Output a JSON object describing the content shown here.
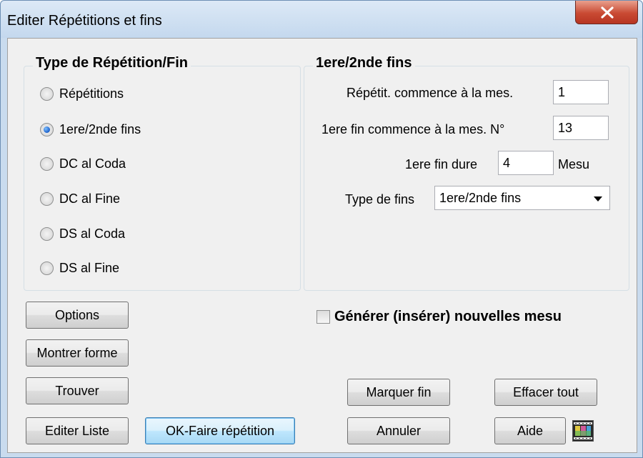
{
  "window": {
    "title": "Editer Répétitions et fins"
  },
  "type_group": {
    "title": "Type de Répétition/Fin",
    "options": [
      {
        "label": "Répétitions",
        "checked": false
      },
      {
        "label": "1ere/2nde fins",
        "checked": true
      },
      {
        "label": "DC al Coda",
        "checked": false
      },
      {
        "label": "DC al Fine",
        "checked": false
      },
      {
        "label": "DS al Coda",
        "checked": false
      },
      {
        "label": "DS al Fine",
        "checked": false
      }
    ]
  },
  "endings_group": {
    "title": "1ere/2nde fins",
    "repeat_start_label": "Répétit. commence à la mes.",
    "repeat_start_value": "1",
    "first_ending_start_label": "1ere fin commence à la mes. N°",
    "first_ending_start_value": "13",
    "first_ending_length_label": "1ere fin dure",
    "first_ending_length_value": "4",
    "first_ending_length_unit": "Mesu",
    "endings_type_label": "Type de fins",
    "endings_type_value": "1ere/2nde fins"
  },
  "generate_checkbox": {
    "label": "Générer (insérer) nouvelles mesu",
    "checked": false
  },
  "buttons": {
    "options": "Options",
    "show_form": "Montrer forme",
    "find": "Trouver",
    "edit_list": "Editer Liste",
    "ok": "OK-Faire répétition",
    "mark_end": "Marquer fin",
    "clear_all": "Effacer tout",
    "cancel": "Annuler",
    "help": "Aide"
  },
  "icons": {
    "close": "close-icon",
    "film": "film-icon"
  }
}
